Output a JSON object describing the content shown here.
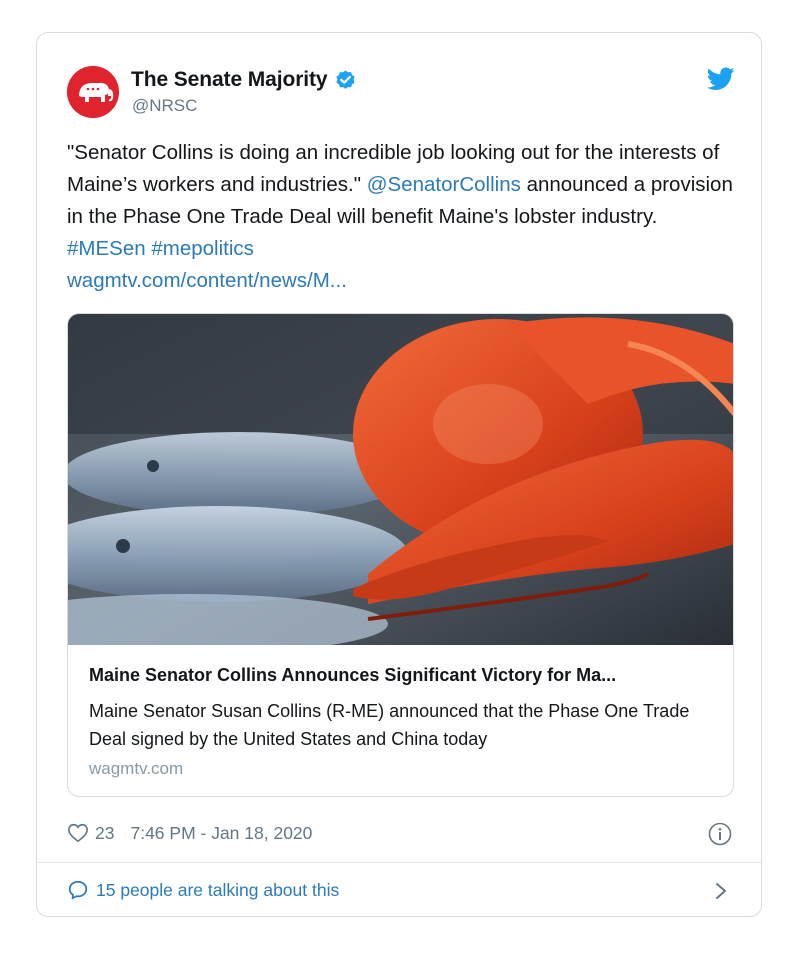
{
  "author": {
    "name": "The Senate Majority",
    "handle": "@NRSC",
    "verified": true,
    "avatar_icon": "elephant-logo-icon"
  },
  "tweet": {
    "text_part1": "\"Senator Collins is doing an incredible job looking out for the interests of Maine’s workers and industries.\" ",
    "mention": "@SenatorCollins",
    "text_part2": " announced a provision in the Phase One Trade Deal will benefit Maine's lobster industry. ",
    "hashtag1": "#MESen",
    "hashtag2": "#mepolitics",
    "link": "wagmtv.com/content/news/M..."
  },
  "card": {
    "image_icon": "lobster-photo",
    "title": "Maine Senator Collins Announces Significant Victory for Ma...",
    "description": "Maine Senator Susan Collins (R-ME) announced that the Phase One Trade Deal signed by the United States and China today",
    "domain": "wagmtv.com"
  },
  "meta": {
    "like_count": "23",
    "timestamp": "7:46 PM - Jan 18, 2020"
  },
  "footer": {
    "talking": "15 people are talking about this"
  },
  "colors": {
    "link": "#2b7bb9",
    "secondary_text": "#657786",
    "avatar_bg": "#e0242d",
    "verified": "#1da1f2"
  }
}
